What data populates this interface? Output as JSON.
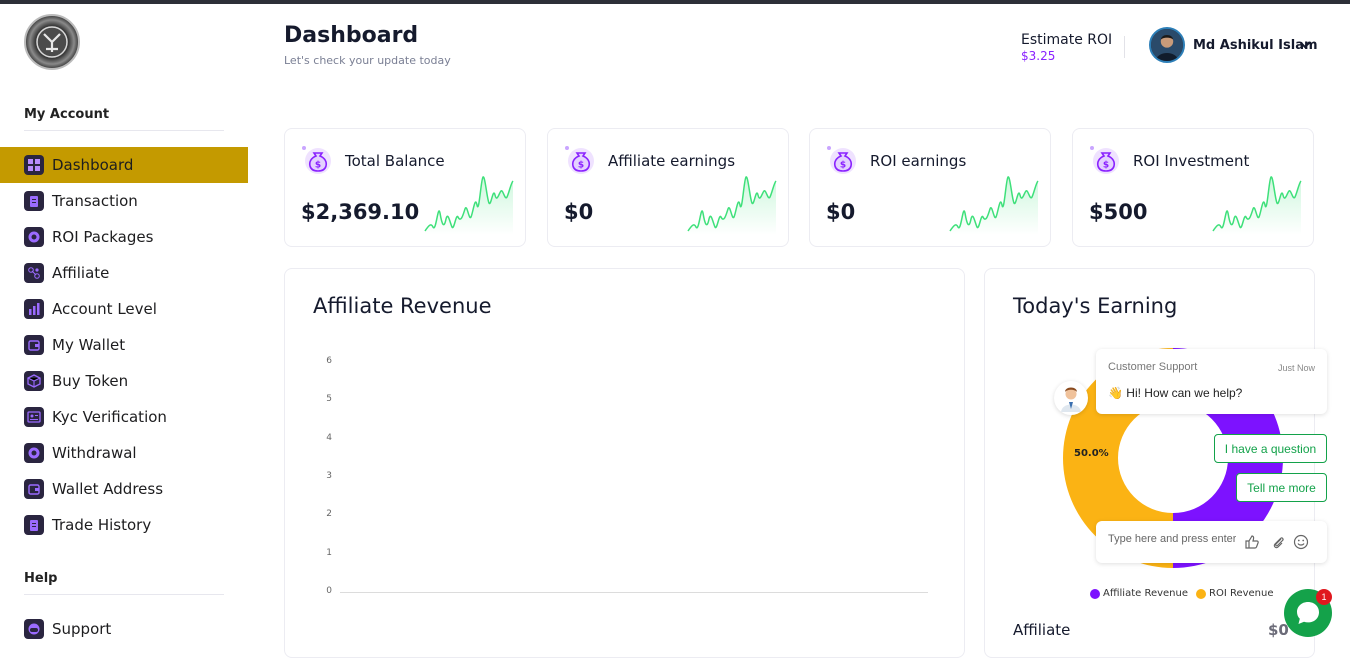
{
  "header": {
    "title": "Dashboard",
    "subtitle": "Let's check your update today",
    "roi_label": "Estimate ROI",
    "roi_value": "$3.25",
    "user_name": "Md Ashikul Islam"
  },
  "sidebar": {
    "my_account_title": "My Account",
    "help_title": "Help",
    "items": [
      {
        "label": "Dashboard",
        "icon": "dashboard-grid-icon"
      },
      {
        "label": "Transaction",
        "icon": "clipboard-icon"
      },
      {
        "label": "ROI Packages",
        "icon": "coin-icon"
      },
      {
        "label": "Affiliate",
        "icon": "network-icon"
      },
      {
        "label": "Account Level",
        "icon": "bar-chart-icon"
      },
      {
        "label": "My Wallet",
        "icon": "wallet-icon"
      },
      {
        "label": "Buy Token",
        "icon": "cube-icon"
      },
      {
        "label": "Kyc Verification",
        "icon": "id-card-icon"
      },
      {
        "label": "Withdrawal",
        "icon": "coin-icon"
      },
      {
        "label": "Wallet Address",
        "icon": "wallet-icon"
      },
      {
        "label": "Trade History",
        "icon": "clipboard-icon"
      }
    ],
    "help_items": [
      {
        "label": "Support",
        "icon": "support-icon"
      }
    ]
  },
  "cards": [
    {
      "title": "Total Balance",
      "value": "$2,369.10"
    },
    {
      "title": "Affiliate earnings",
      "value": "$0"
    },
    {
      "title": "ROI earnings",
      "value": "$0"
    },
    {
      "title": "ROI Investment",
      "value": "$500"
    }
  ],
  "colors": {
    "accent_gold": "#c49a00",
    "accent_purple": "#8a22ff",
    "sparkline_green": "#3ee07a",
    "donut_orange": "#fbb314",
    "donut_purple": "#7d12ff",
    "chat_green": "#13a24a"
  },
  "revenue": {
    "title": "Affiliate Revenue",
    "y_ticks": [
      "0",
      "1",
      "2",
      "3",
      "4",
      "5",
      "6"
    ]
  },
  "earning": {
    "title": "Today's Earning",
    "donut_label": "50.0%",
    "legend": [
      "Affiliate Revenue",
      "ROI Revenue"
    ],
    "row_label": "Affiliate",
    "row_value": "$0"
  },
  "chart_data": {
    "type": "pie",
    "title": "Today's Earning",
    "categories": [
      "Affiliate Revenue",
      "ROI Revenue"
    ],
    "values": [
      50.0,
      50.0
    ]
  },
  "chat": {
    "agent_name": "Customer Support",
    "time": "Just Now",
    "message": "👋 Hi! How can we help?",
    "option_1": "I have a question",
    "option_2": "Tell me more",
    "input_placeholder": "Type here and press enter..",
    "badge_count": "1"
  }
}
